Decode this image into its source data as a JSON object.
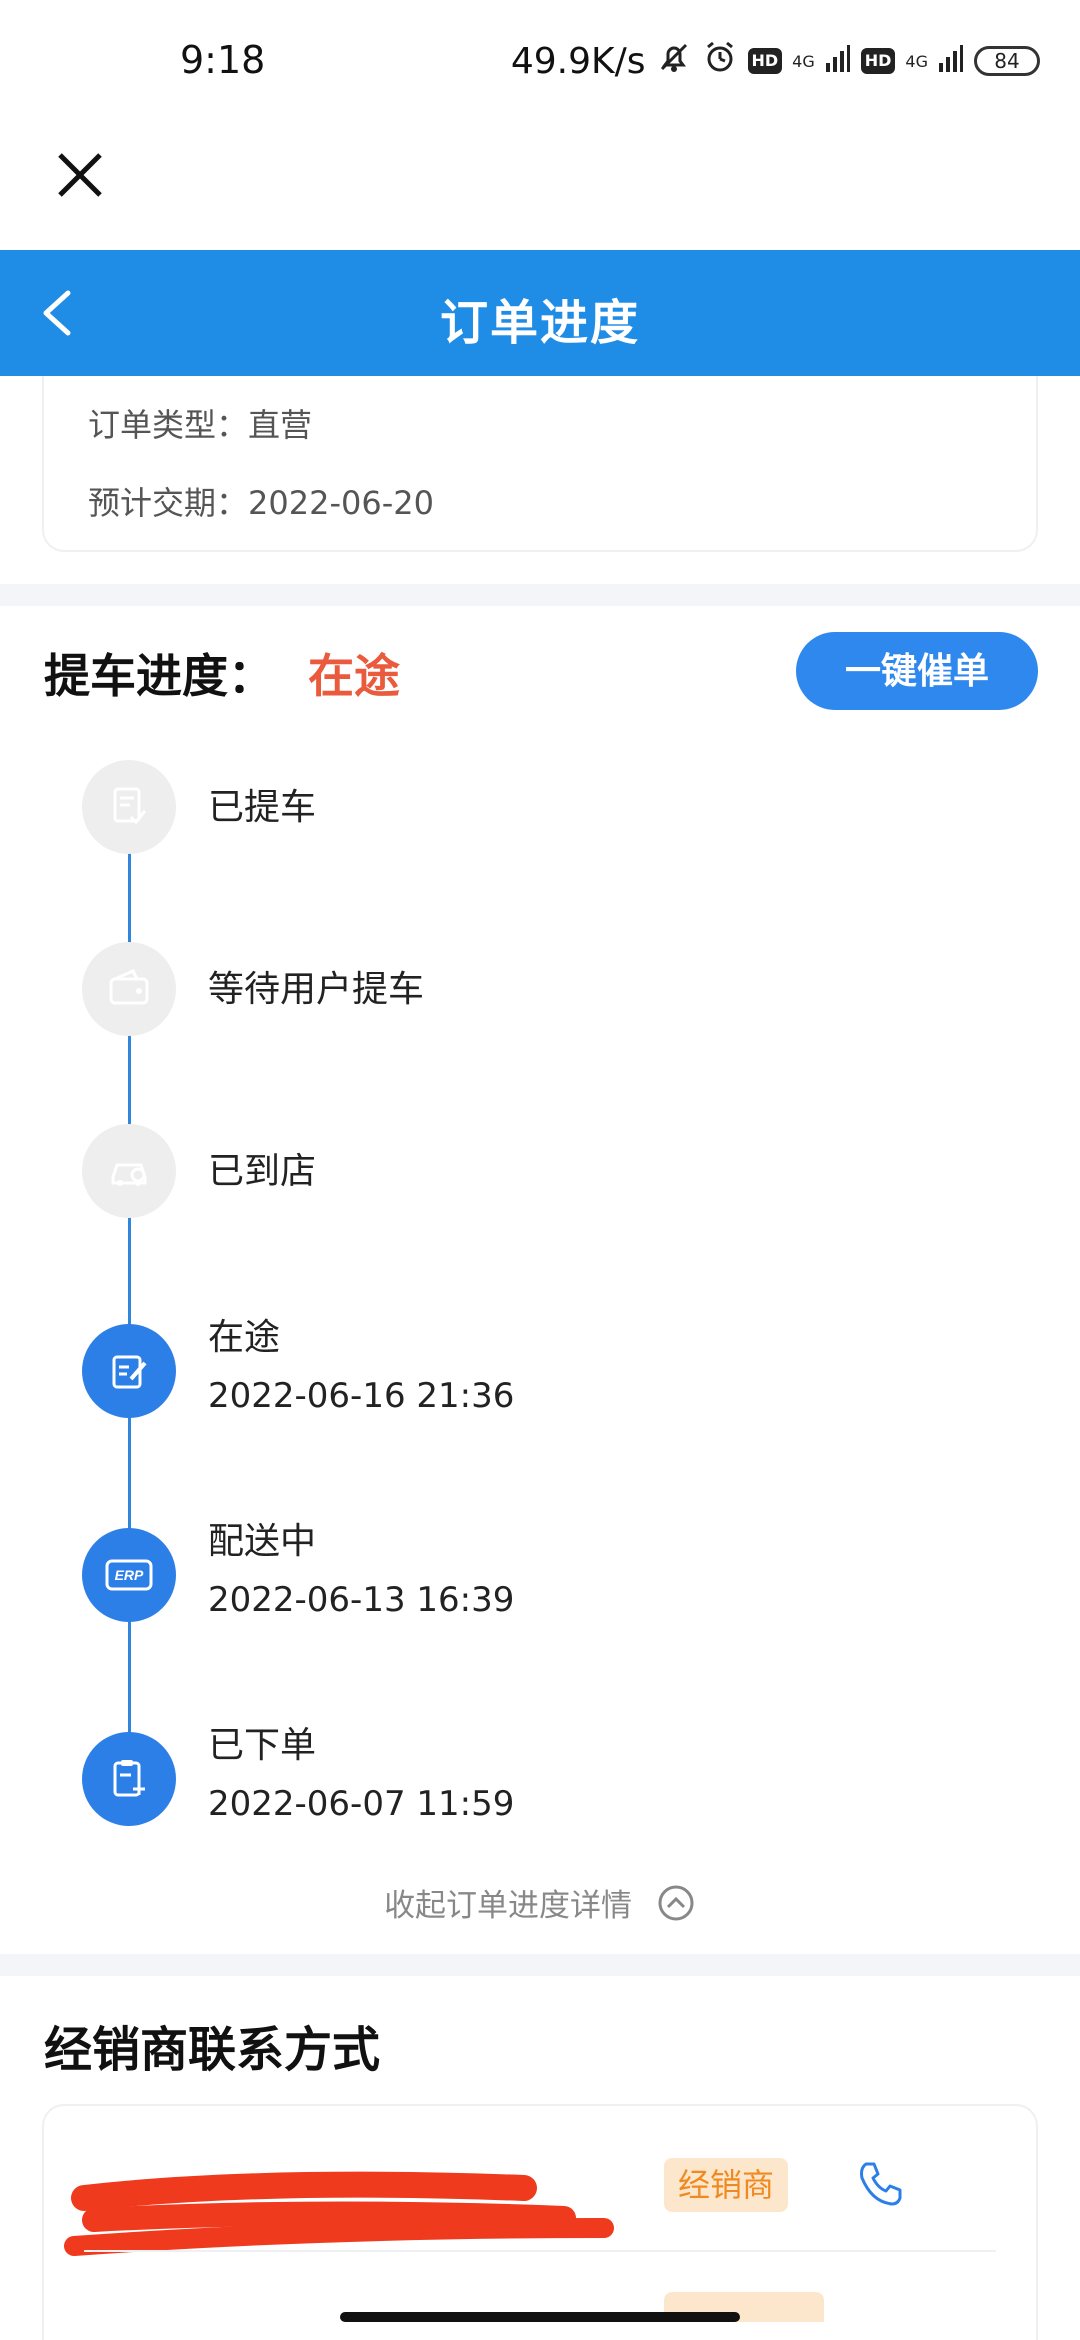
{
  "status_bar": {
    "time": "9:18",
    "net_speed": "49.9K/s",
    "hd1": "HD",
    "sig1": "4G",
    "hd2": "HD",
    "sig2": "4G",
    "battery": "84"
  },
  "header": {
    "title": "订单进度"
  },
  "order_info": {
    "type_label": "订单类型：直营",
    "delivery_label": "预计交期：2022-06-20"
  },
  "progress": {
    "title": "提车进度：",
    "status": "在途",
    "urge_button": "一键催单",
    "steps": [
      {
        "label": "已提车",
        "time": "",
        "state": "done",
        "icon": "document-check-icon"
      },
      {
        "label": "等待用户提车",
        "time": "",
        "state": "done",
        "icon": "wallet-icon"
      },
      {
        "label": "已到店",
        "time": "",
        "state": "done",
        "icon": "car-store-icon"
      },
      {
        "label": "在途",
        "time": "2022-06-16 21:36",
        "state": "active",
        "icon": "edit-note-icon"
      },
      {
        "label": "配送中",
        "time": "2022-06-13 16:39",
        "state": "active",
        "icon": "erp-icon"
      },
      {
        "label": "已下单",
        "time": "2022-06-07 11:59",
        "state": "active",
        "icon": "clipboard-add-icon"
      }
    ],
    "collapse_text": "收起订单进度详情"
  },
  "dealer": {
    "title": "经销商联系方式",
    "tag": "经销商"
  },
  "colors": {
    "primary": "#1f8ce6",
    "status_red": "#ea5a3c",
    "tag_bg": "#fde7cc",
    "tag_text": "#f08a20"
  }
}
